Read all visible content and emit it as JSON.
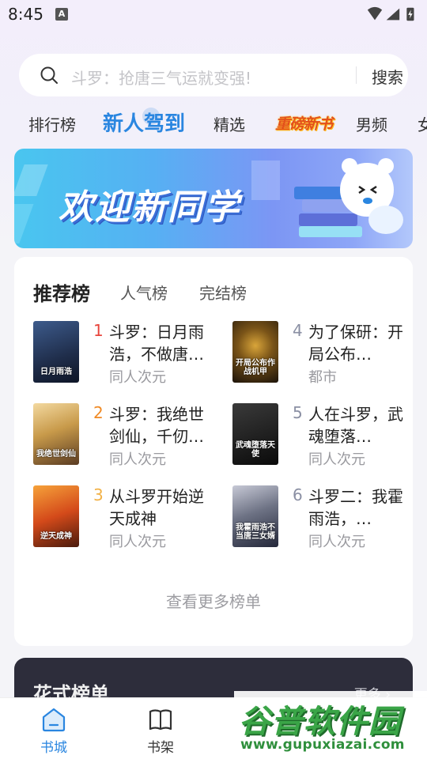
{
  "status": {
    "time": "8:45",
    "notification_letter": "A"
  },
  "search": {
    "placeholder": "斗罗：抢唐三气运就变强!",
    "button": "搜索"
  },
  "tabs": [
    {
      "label": "排行榜"
    },
    {
      "label": "新人驾到",
      "active": true
    },
    {
      "label": "精选"
    },
    {
      "label": "重磅新书"
    },
    {
      "label": "男频"
    },
    {
      "label": "女"
    }
  ],
  "banner": {
    "text": "欢迎新同学"
  },
  "rank": {
    "tabs": [
      "推荐榜",
      "人气榜",
      "完结榜"
    ],
    "books": [
      {
        "rank": "1",
        "title": "斗罗：日月雨浩，不做唐…",
        "category": "同人次元",
        "cover_text": "日月雨浩",
        "rank_color": "#e8453c"
      },
      {
        "rank": "2",
        "title": "斗罗：我绝世剑仙，千仞…",
        "category": "同人次元",
        "cover_text": "我绝世剑仙",
        "rank_color": "#f08a24"
      },
      {
        "rank": "3",
        "title": "从斗罗开始逆天成神",
        "category": "同人次元",
        "cover_text": "逆天成神",
        "rank_color": "#f2b146"
      },
      {
        "rank": "4",
        "title": "为了保研：开局公布…",
        "category": "都市",
        "cover_text": "开局公布作战机甲",
        "rank_color": "#8a8fa3"
      },
      {
        "rank": "5",
        "title": "人在斗罗，武魂堕落…",
        "category": "同人次元",
        "cover_text": "武魂堕落天使",
        "rank_color": "#8a8fa3"
      },
      {
        "rank": "6",
        "title": "斗罗二：我霍雨浩，…",
        "category": "同人次元",
        "cover_text": "我霍雨浩不当唐三女婿",
        "rank_color": "#8a8fa3"
      }
    ],
    "more": "查看更多榜单"
  },
  "fancy": {
    "title": "花式榜单",
    "more": "更多 ›"
  },
  "nav": [
    {
      "label": "书城",
      "active": true
    },
    {
      "label": "书架"
    }
  ],
  "watermark": {
    "text": "谷普软件园",
    "url": "www.gupuxiazai.com"
  },
  "colors": {
    "accent": "#2a86e0",
    "dark_card": "#2d2d3b"
  }
}
